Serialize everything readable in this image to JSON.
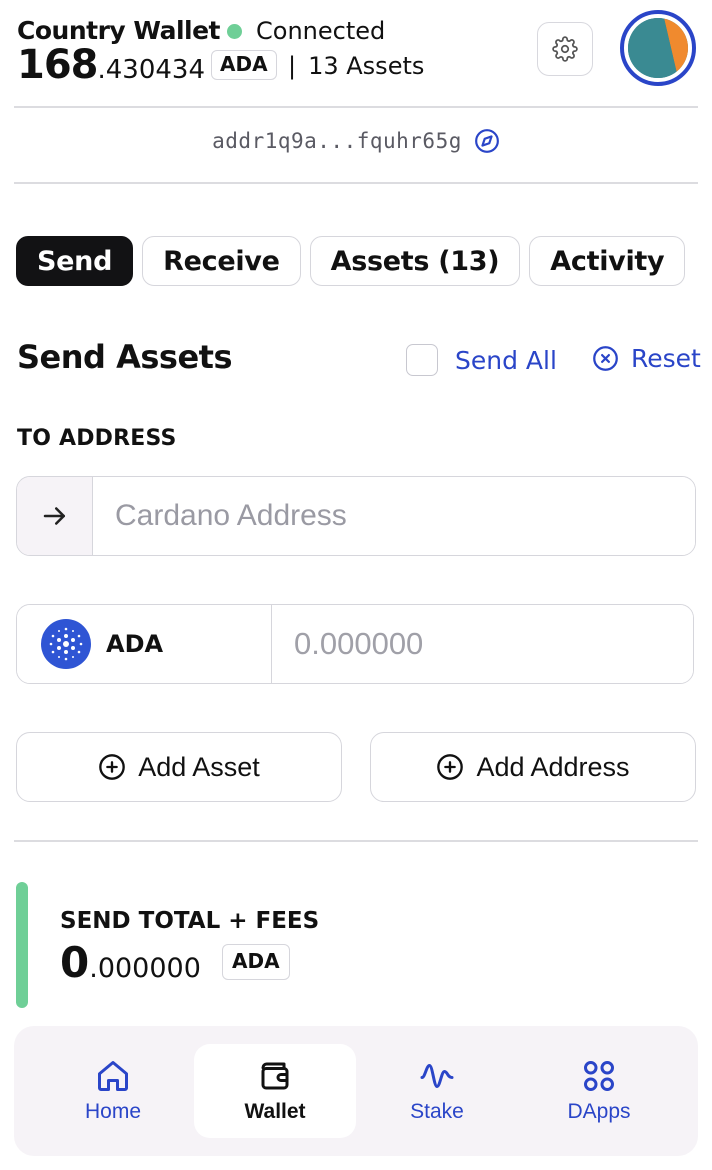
{
  "header": {
    "wallet_name": "Country Wallet",
    "status": "Connected",
    "balance_int": "168",
    "balance_dec": ".430434",
    "currency": "ADA",
    "asset_count": "13 Assets",
    "separator": "|"
  },
  "address": {
    "short": "addr1q9a...fquhr65g"
  },
  "tabs": [
    {
      "label": "Send",
      "active": true
    },
    {
      "label": "Receive",
      "active": false
    },
    {
      "label": "Assets (13)",
      "active": false
    },
    {
      "label": "Activity",
      "active": false
    }
  ],
  "send": {
    "title": "Send Assets",
    "send_all_label": "Send All",
    "reset_label": "Reset",
    "to_address_label": "TO ADDRESS",
    "address_placeholder": "Cardano Address",
    "asset_name": "ADA",
    "amount_placeholder": "0.000000",
    "add_asset_label": "Add Asset",
    "add_address_label": "Add Address"
  },
  "total": {
    "label": "SEND TOTAL + FEES",
    "amount_int": "0",
    "amount_dec": ".000000",
    "currency": "ADA"
  },
  "nav": [
    {
      "label": "Home",
      "icon": "home-icon",
      "active": false
    },
    {
      "label": "Wallet",
      "icon": "wallet-icon",
      "active": true
    },
    {
      "label": "Stake",
      "icon": "pulse-icon",
      "active": false
    },
    {
      "label": "DApps",
      "icon": "grid-icon",
      "active": false
    }
  ],
  "colors": {
    "accent": "#2a45c8",
    "status_green": "#6fcf97",
    "tab_active_bg": "#121214",
    "nav_bg": "#f6f3f7"
  }
}
